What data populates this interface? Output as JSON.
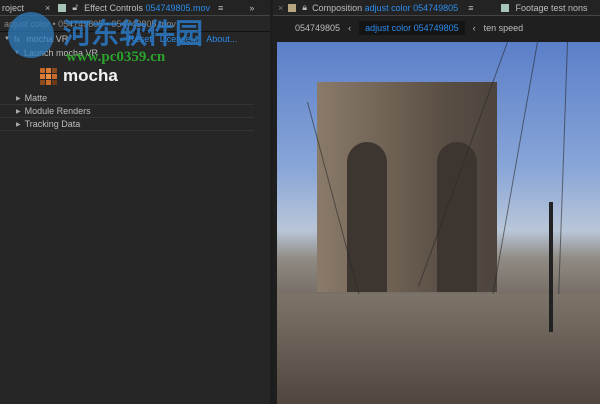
{
  "left_tabs": {
    "project": "roject",
    "effect_controls_label": "Effect Controls",
    "effect_controls_file": "054749805.mov"
  },
  "right_tabs": {
    "composition_label": "Composition",
    "composition_name": "adjust color 054749805",
    "footage_label": "Footage test nons"
  },
  "effect_controls": {
    "breadcrumb": "adjust color • 054749805 • 054749805.mov",
    "effect_name": "mocha VR",
    "reset": "Reset",
    "license": "License...",
    "about": "About...",
    "launch": "Launch mocha VR",
    "logo_text": "mocha",
    "groups": [
      "Matte",
      "Module Renders",
      "Tracking Data"
    ]
  },
  "comp_nav": {
    "items": [
      "054749805",
      "adjust color 054749805",
      "ten speed"
    ]
  },
  "watermark": {
    "title": "河东软件园",
    "url": "www.pc0359.cn"
  }
}
